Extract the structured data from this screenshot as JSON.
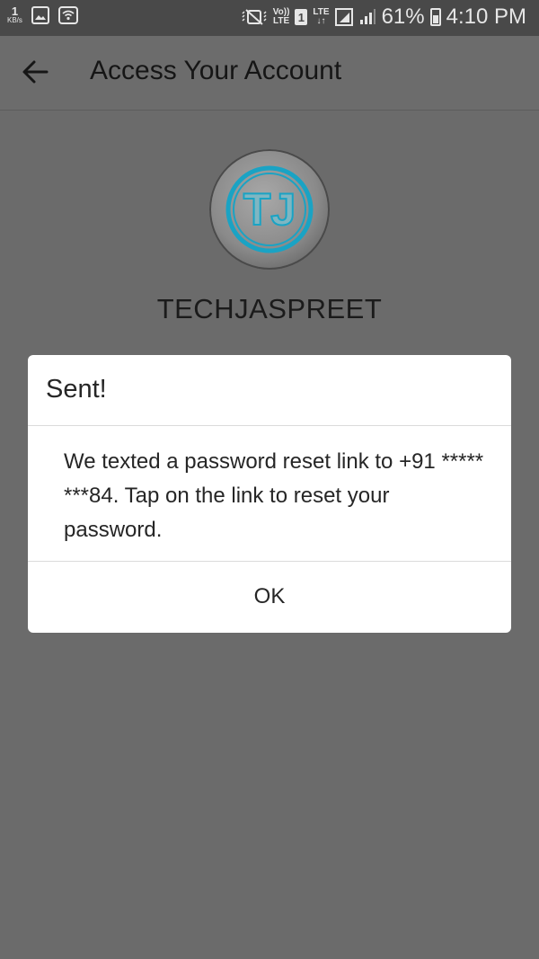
{
  "status_bar": {
    "data_rate_value": "1",
    "data_rate_unit": "KB/s",
    "volte_label_top": "Vo))",
    "volte_label_bottom": "LTE",
    "sim_slot": "1",
    "lte_label_top": "LTE",
    "lte_label_bottom": "↓↑",
    "battery_percent": "61%",
    "time": "4:10 PM"
  },
  "app_bar": {
    "title": "Access Your Account"
  },
  "account": {
    "username": "TECHJASPREET",
    "avatar_monogram": "TJ"
  },
  "dialog": {
    "title": "Sent!",
    "message": "We texted a password reset link to +91 ***** ***84. Tap on the link to reset your password.",
    "ok_label": "OK"
  },
  "colors": {
    "dim_background": "#6b6b6b",
    "status_bar": "#494949",
    "dialog_background": "#ffffff",
    "avatar_accent": "#1aa3c4"
  }
}
